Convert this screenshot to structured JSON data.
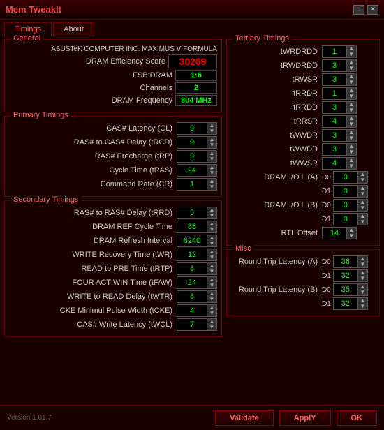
{
  "window": {
    "title": "Mem TweakIt",
    "min_btn": "–",
    "close_btn": "✕"
  },
  "tabs": [
    {
      "label": "Timings",
      "active": true
    },
    {
      "label": "About",
      "active": false
    }
  ],
  "general": {
    "title": "General",
    "mobo": "ASUSTeK COMPUTER INC. MAXIMUS V FORMULA",
    "dram_efficiency_label": "DRAM Efficiency Score",
    "dram_efficiency_value": "30269",
    "fsb_label": "FSB:DRAM",
    "fsb_value": "1:6",
    "channels_label": "Channels",
    "channels_value": "2",
    "dram_freq_label": "DRAM Frequency",
    "dram_freq_value": "804 MHz"
  },
  "primary": {
    "title": "Primary Timings",
    "rows": [
      {
        "label": "CAS# Latency (CL)",
        "value": "9"
      },
      {
        "label": "RAS# to CAS# Delay (tRCD)",
        "value": "9"
      },
      {
        "label": "RAS# Precharge (tRP)",
        "value": "9"
      },
      {
        "label": "Cycle Time (tRAS)",
        "value": "24"
      },
      {
        "label": "Command Rate (CR)",
        "value": "1"
      }
    ]
  },
  "secondary": {
    "title": "Secondary Timings",
    "rows": [
      {
        "label": "RAS# to RAS# Delay (tRRD)",
        "value": "5"
      },
      {
        "label": "DRAM REF Cycle Time",
        "value": "88"
      },
      {
        "label": "DRAM Refresh Interval",
        "value": "6240"
      },
      {
        "label": "WRITE Recovery Time (tWR)",
        "value": "12"
      },
      {
        "label": "READ to PRE Time (tRTP)",
        "value": "6"
      },
      {
        "label": "FOUR ACT WIN Time (tFAW)",
        "value": "24"
      },
      {
        "label": "WRITE to READ Delay (tWTR)",
        "value": "6"
      },
      {
        "label": "CKE Minimul Pulse Width (tCKE)",
        "value": "4"
      },
      {
        "label": "CAS# Write Latency (tWCL)",
        "value": "7"
      }
    ]
  },
  "tertiary": {
    "title": "Tertiary Timings",
    "rows": [
      {
        "label": "tWRDRDD",
        "value": "1"
      },
      {
        "label": "tRWDRDD",
        "value": "3"
      },
      {
        "label": "tRWSR",
        "value": "3"
      },
      {
        "label": "tRRDR",
        "value": "1"
      },
      {
        "label": "tRRDD",
        "value": "3"
      },
      {
        "label": "tRRSR",
        "value": "4"
      },
      {
        "label": "tWWDR",
        "value": "3"
      },
      {
        "label": "tWWDD",
        "value": "3"
      },
      {
        "label": "tWWSR",
        "value": "4"
      }
    ],
    "dram_io_a": {
      "label": "DRAM I/O L (A)",
      "d0_label": "D0",
      "d0_value": "0",
      "d1_label": "D1",
      "d1_value": "0"
    },
    "dram_io_b": {
      "label": "DRAM I/O L (B)",
      "d0_label": "D0",
      "d0_value": "0",
      "d1_label": "D1",
      "d1_value": "0"
    },
    "rtl_offset": {
      "label": "RTL Offset",
      "value": "14"
    }
  },
  "misc": {
    "title": "Misc",
    "round_trip_a": {
      "label": "Round Trip Latency (A)",
      "d0_label": "D0",
      "d0_value": "36",
      "d1_label": "D1",
      "d1_value": "32"
    },
    "round_trip_b": {
      "label": "Round Trip Latency (B)",
      "d0_label": "D0",
      "d0_value": "35",
      "d1_label": "D1",
      "d1_value": "32"
    }
  },
  "buttons": {
    "validate": "Validate",
    "apply": "ApplY",
    "ok": "OK"
  },
  "version": "Version 1.01.7"
}
